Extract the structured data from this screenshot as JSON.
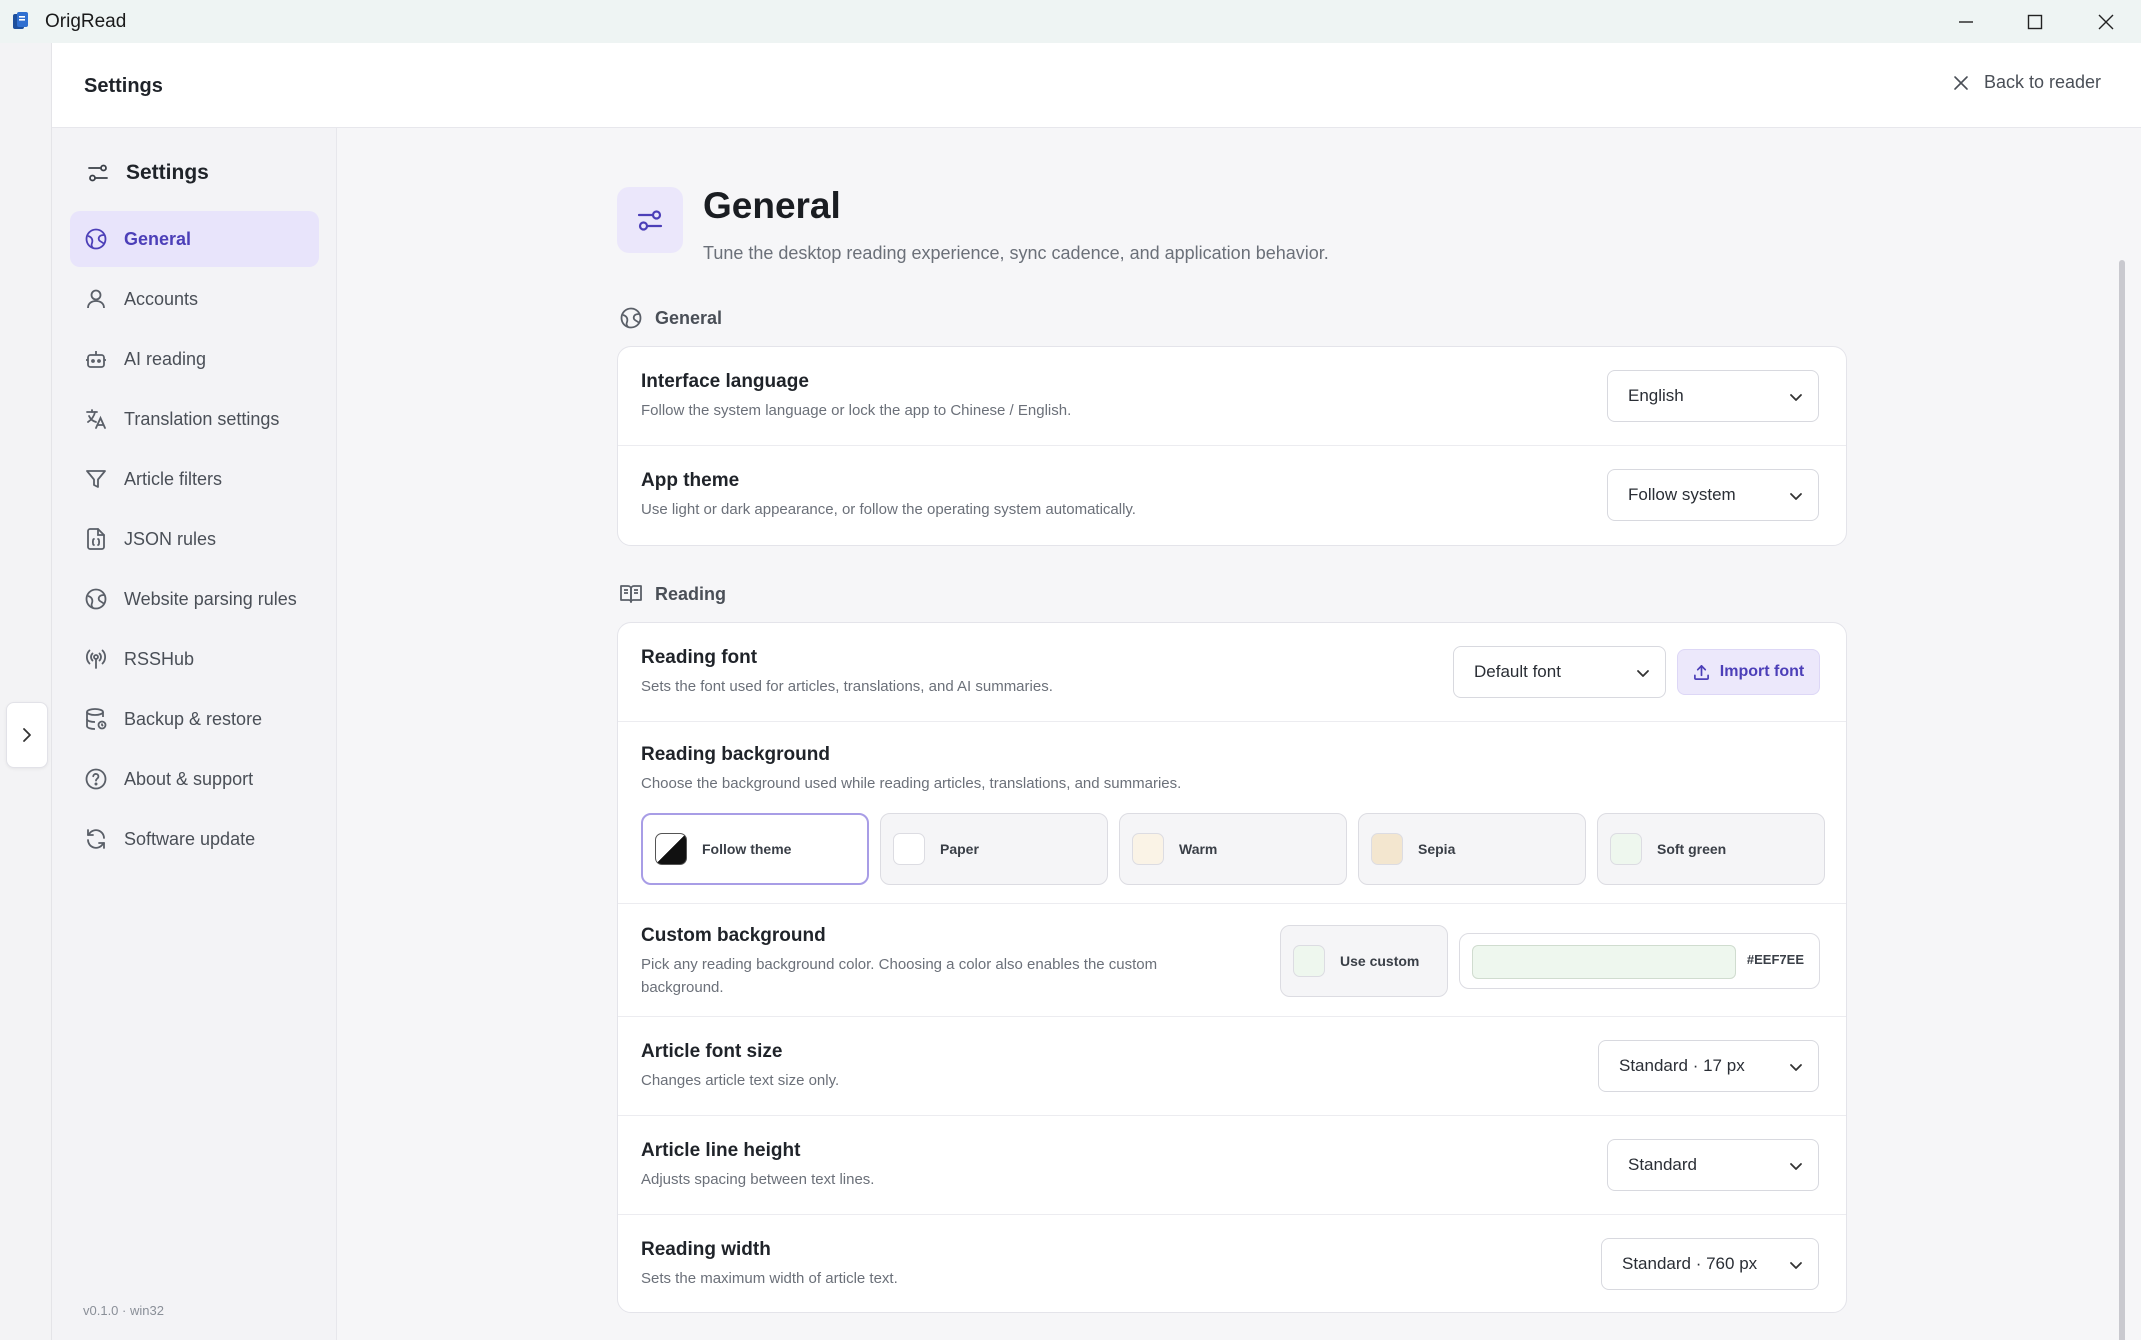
{
  "window": {
    "title": "OrigRead",
    "controls": [
      "minimize-icon",
      "maximize-icon",
      "close-icon"
    ]
  },
  "header": {
    "title": "Settings",
    "back_label": "Back to reader"
  },
  "sidebar": {
    "heading": "Settings",
    "items": [
      {
        "label": "General",
        "icon": "globe-icon",
        "active": true
      },
      {
        "label": "Accounts",
        "icon": "user-icon",
        "active": false
      },
      {
        "label": "AI reading",
        "icon": "robot-icon",
        "active": false
      },
      {
        "label": "Translation settings",
        "icon": "translate-icon",
        "active": false
      },
      {
        "label": "Article filters",
        "icon": "filter-icon",
        "active": false
      },
      {
        "label": "JSON rules",
        "icon": "json-file-icon",
        "active": false
      },
      {
        "label": "Website parsing rules",
        "icon": "globe-icon",
        "active": false
      },
      {
        "label": "RSSHub",
        "icon": "broadcast-icon",
        "active": false
      },
      {
        "label": "Backup & restore",
        "icon": "database-icon",
        "active": false
      },
      {
        "label": "About & support",
        "icon": "help-circle-icon",
        "active": false
      },
      {
        "label": "Software update",
        "icon": "refresh-icon",
        "active": false
      }
    ],
    "version": "v0.1.0 · win32"
  },
  "page": {
    "title": "General",
    "subtitle": "Tune the desktop reading experience, sync cadence, and application behavior."
  },
  "sections": {
    "general": {
      "label": "General",
      "interface_language": {
        "title": "Interface language",
        "desc": "Follow the system language or lock the app to Chinese / English.",
        "value": "English"
      },
      "app_theme": {
        "title": "App theme",
        "desc": "Use light or dark appearance, or follow the operating system automatically.",
        "value": "Follow system"
      }
    },
    "reading": {
      "label": "Reading",
      "font": {
        "title": "Reading font",
        "desc": "Sets the font used for articles, translations, and AI summaries.",
        "value": "Default font",
        "import_label": "Import font"
      },
      "background": {
        "title": "Reading background",
        "desc": "Choose the background used while reading articles, translations, and summaries.",
        "options": [
          {
            "label": "Follow theme",
            "color": "theme",
            "selected": true
          },
          {
            "label": "Paper",
            "color": "#ffffff",
            "selected": false
          },
          {
            "label": "Warm",
            "color": "#faf3e6",
            "selected": false
          },
          {
            "label": "Sepia",
            "color": "#f3e6cf",
            "selected": false
          },
          {
            "label": "Soft green",
            "color": "#eef7ee",
            "selected": false
          }
        ]
      },
      "custom_background": {
        "title": "Custom background",
        "desc": "Pick any reading background color. Choosing a color also enables the custom background.",
        "use_custom_label": "Use custom",
        "color": "#EEF7EE",
        "hex": "#EEF7EE"
      },
      "font_size": {
        "title": "Article font size",
        "desc": "Changes article text size only.",
        "value": "Standard · 17 px"
      },
      "line_height": {
        "title": "Article line height",
        "desc": "Adjusts spacing between text lines.",
        "value": "Standard"
      },
      "reading_width": {
        "title": "Reading width",
        "desc": "Sets the maximum width of article text.",
        "value": "Standard · 760 px"
      }
    }
  },
  "colors": {
    "accent": "#4c3fb8",
    "accent_bg": "#e8e4fb",
    "titlebar": "#eef4f3"
  }
}
